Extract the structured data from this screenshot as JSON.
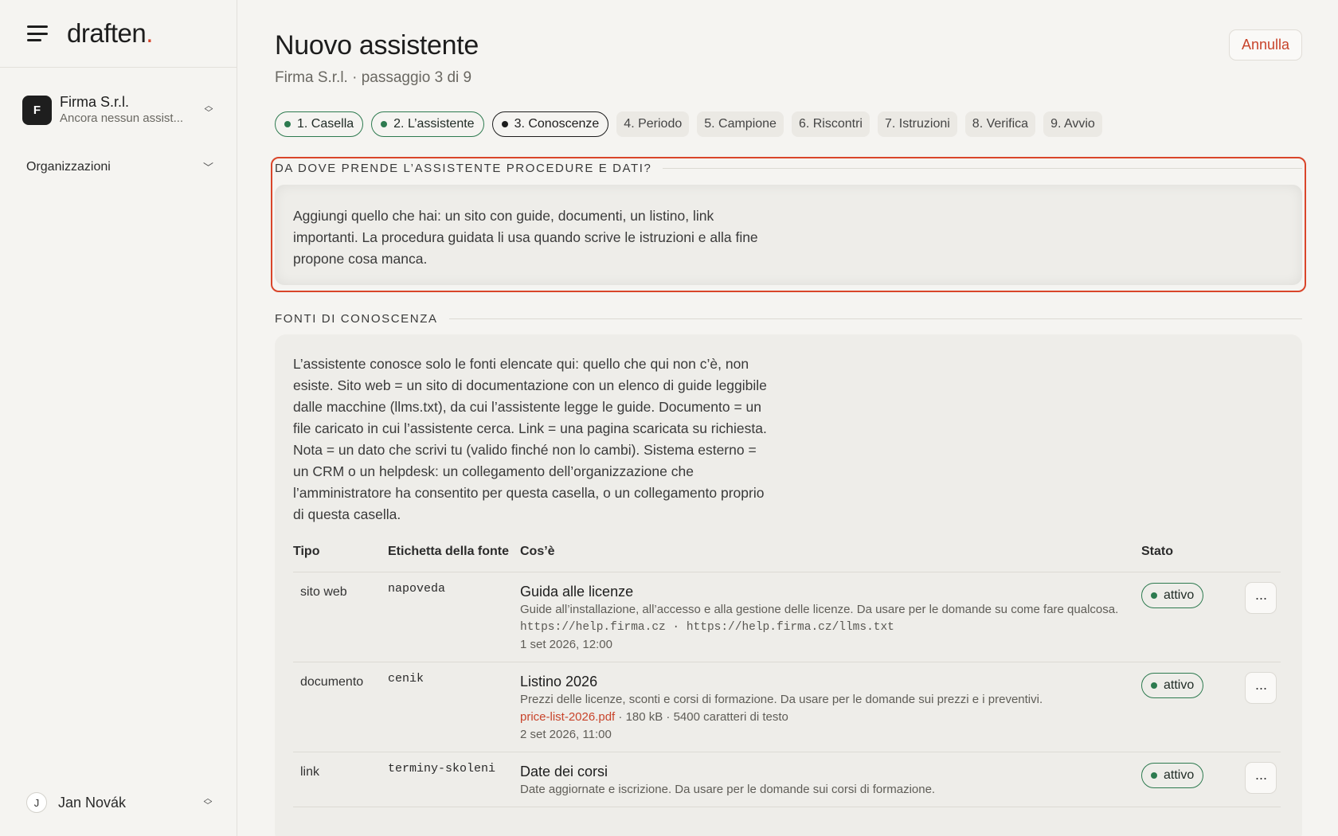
{
  "brand": {
    "logo_text": "draften",
    "logo_dot": "."
  },
  "sidebar": {
    "org": {
      "initial": "F",
      "name": "Firma S.r.l.",
      "subtitle": "Ancora nessun assist..."
    },
    "organizations_label": "Organizzazioni",
    "user": {
      "initial": "J",
      "name": "Jan Novák"
    }
  },
  "header": {
    "title": "Nuovo assistente",
    "subtitle": "Firma S.r.l. · passaggio 3 di 9",
    "cancel_label": "Annulla"
  },
  "steps": [
    {
      "label": "1. Casella",
      "state": "done"
    },
    {
      "label": "2. L’assistente",
      "state": "done"
    },
    {
      "label": "3. Conoscenze",
      "state": "current"
    },
    {
      "label": "4. Periodo",
      "state": "pending"
    },
    {
      "label": "5. Campione",
      "state": "pending"
    },
    {
      "label": "6. Riscontri",
      "state": "pending"
    },
    {
      "label": "7. Istruzioni",
      "state": "pending"
    },
    {
      "label": "8. Verifica",
      "state": "pending"
    },
    {
      "label": "9. Avvio",
      "state": "pending"
    }
  ],
  "section_where": {
    "title": "DA DOVE PRENDE L’ASSISTENTE PROCEDURE E DATI?",
    "text": "Aggiungi quello che hai: un sito con guide, documenti, un listino, link importanti. La procedura guidata li usa quando scrive le istruzioni e alla fine propone cosa manca."
  },
  "section_sources": {
    "title": "FONTI DI CONOSCENZA",
    "text": "L’assistente conosce solo le fonti elencate qui: quello che qui non c’è, non esiste. Sito web = un sito di documentazione con un elenco di guide leggibile dalle macchine (llms.txt), da cui l’assistente legge le guide. Documento = un file caricato in cui l’assistente cerca. Link = una pagina scaricata su richiesta. Nota = un dato che scrivi tu (valido finché non lo cambi). Sistema esterno = un CRM o un helpdesk: un collegamento dell’organizzazione che l’amministratore ha consentito per questa casella, o un collegamento proprio di questa casella.",
    "columns": {
      "type": "Tipo",
      "label": "Etichetta della fonte",
      "what": "Cos’è",
      "state": "Stato"
    },
    "rows": [
      {
        "type": "sito web",
        "label": "napoveda",
        "name": "Guida alle licenze",
        "desc": "Guide all’installazione, all’accesso e alla gestione delle licenze. Da usare per le domande su come fare qualcosa.",
        "urls": "https://help.firma.cz · https://help.firma.cz/llms.txt",
        "date": "1 set 2026, 12:00",
        "state": "attivo"
      },
      {
        "type": "documento",
        "label": "cenik",
        "name": "Listino 2026",
        "desc": "Prezzi delle licenze, sconti e corsi di formazione. Da usare per le domande sui prezzi e i preventivi.",
        "file": "price-list-2026.pdf",
        "file_meta": " · 180 kB · 5400 caratteri di testo",
        "date": "2 set 2026, 11:00",
        "state": "attivo"
      },
      {
        "type": "link",
        "label": "terminy-skoleni",
        "name": "Date dei corsi",
        "desc": "Date aggiornate e iscrizione. Da usare per le domande sui corsi di formazione.",
        "state": "attivo"
      }
    ],
    "menu_label": "···"
  }
}
